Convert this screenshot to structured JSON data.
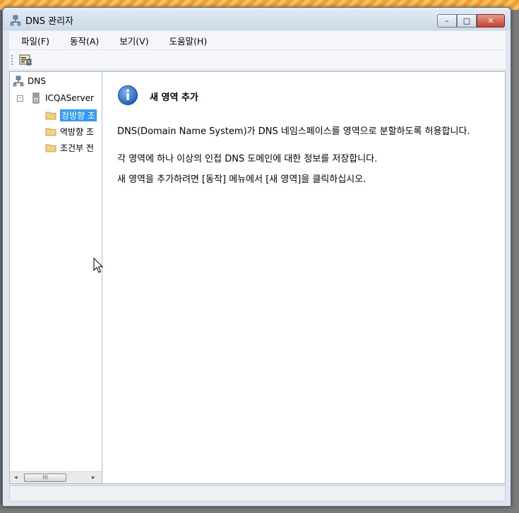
{
  "window": {
    "title": "DNS 관리자",
    "controls": {
      "minimize": "–",
      "maximize": "□",
      "close": "✕"
    }
  },
  "menu": {
    "items": [
      "파일(F)",
      "동작(A)",
      "보기(V)",
      "도움말(H)"
    ]
  },
  "toolbar": {
    "icon": "console-properties-icon"
  },
  "tree": {
    "root": "DNS",
    "server": "ICQAServer",
    "server_expander": "–",
    "children": [
      "정방향 조",
      "역방향 조",
      "조건부 전"
    ],
    "selected_index": 0,
    "scroll": {
      "thumb": "III",
      "left_arrow": "◂",
      "right_arrow": "▸"
    }
  },
  "content": {
    "title": "새 영역 추가",
    "paragraphs": [
      "DNS(Domain Name System)가 DNS 네임스페이스를 영역으로 분할하도록 허용합니다.",
      "각 영역에 하나 이상의 인접 DNS 도메인에 대한 정보를 저장합니다.",
      "새 영역을 추가하려면 [동작] 메뉴에서 [새 영역]을 클릭하십시오."
    ]
  },
  "colors": {
    "selection": "#3399ff",
    "info_icon": "#1e6fd6",
    "folder": "#f2d27a"
  }
}
